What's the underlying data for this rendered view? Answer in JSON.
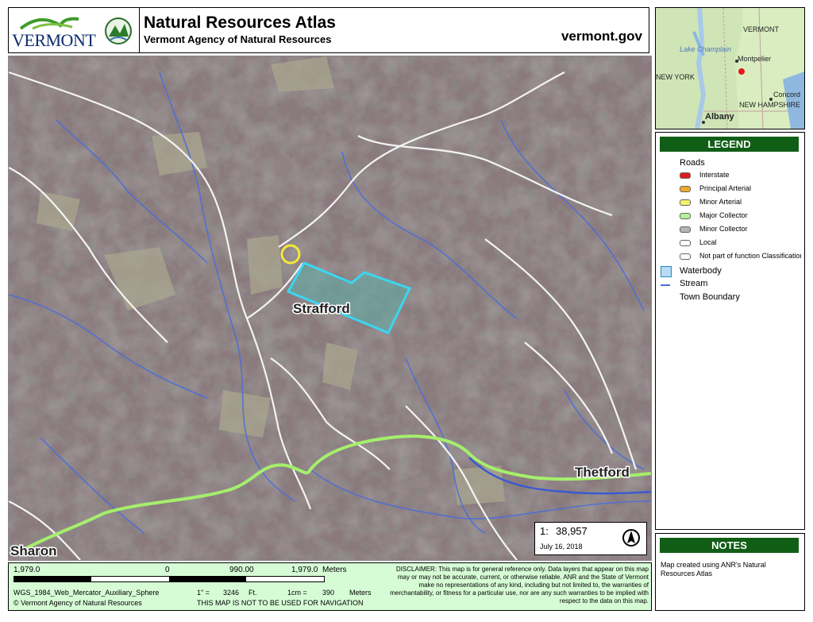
{
  "header": {
    "logo_text": "VERMONT",
    "title": "Natural Resources Atlas",
    "subtitle": "Vermont Agency of Natural Resources",
    "site": "vermont.gov"
  },
  "map": {
    "labels": {
      "strafford": "Strafford",
      "thetford": "Thetford",
      "sharon": "Sharon"
    },
    "scale_label": "1:",
    "scale_value": "38,957",
    "date": "July 16, 2018"
  },
  "inset": {
    "labels": {
      "vermont": "VERMONT",
      "lake": "Lake Champlain",
      "montpelier": "Montpelier",
      "new_york": "NEW YORK",
      "concord": "Concord",
      "new_hampshire": "NEW HAMPSHIRE",
      "albany": "Albany"
    }
  },
  "legend": {
    "title": "LEGEND",
    "roads_heading": "Roads",
    "roads": [
      {
        "label": "Interstate",
        "color": "#e31a1c"
      },
      {
        "label": "Principal Arterial",
        "color": "#f0a830"
      },
      {
        "label": "Minor Arterial",
        "color": "#f4f46a"
      },
      {
        "label": "Major Collector",
        "color": "#b8ef9a"
      },
      {
        "label": "Minor Collector",
        "color": "#b3b3b3"
      },
      {
        "label": "Local",
        "color": "#ffffff"
      },
      {
        "label": "Not part of function Classification S",
        "color": "#ffffff"
      }
    ],
    "waterbody": "Waterbody",
    "stream": "Stream",
    "town_boundary": "Town Boundary"
  },
  "notes": {
    "title": "NOTES",
    "text": "Map created using ANR's Natural Resources Atlas"
  },
  "footer": {
    "scale_left": "1,979.0",
    "scale_zero": "0",
    "scale_mid": "990.00",
    "scale_right": "1,979.0",
    "scale_unit": "Meters",
    "projection": "WGS_1984_Web_Mercator_Auxiliary_Sphere",
    "copyright": "© Vermont Agency of Natural Resources",
    "inch_label": "1\" =",
    "inch_value": "3246",
    "inch_unit": "Ft.",
    "cm_label": "1cm =",
    "cm_value": "390",
    "cm_unit": "Meters",
    "navigation": "THIS MAP IS NOT TO BE USED FOR NAVIGATION",
    "disclaimer": "DISCLAIMER: This map is for general reference only. Data layers that appear on this map may or may not be accurate, current, or otherwise reliable. ANR and the State of Vermont make no representations of any kind, including but not limited to, the warranties of merchantability, or fitness for a particular use, nor are any such warranties to be implied with respect to the data on this map."
  }
}
